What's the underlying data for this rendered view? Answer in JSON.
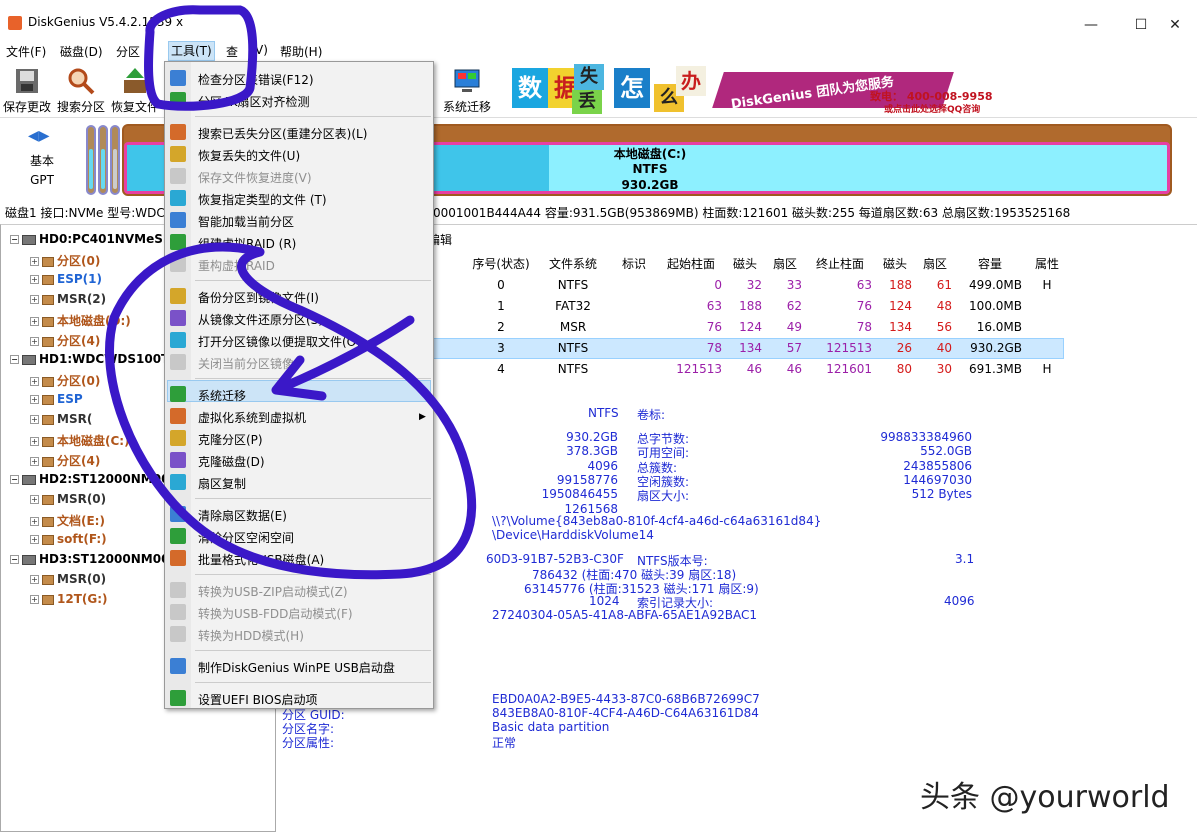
{
  "window": {
    "title": "DiskGenius V5.4.2.1239 x",
    "controls": [
      "—",
      "☐",
      "✕"
    ]
  },
  "menubar": [
    "文件(F)",
    "磁盘(D)",
    "分区",
    "工具(T)",
    "查",
    "帮助(H)"
  ],
  "menubar_tail": "V)",
  "toolbar": {
    "save": "保存更改",
    "search": "搜索分区",
    "recover": "恢复文件",
    "migrate": "系统迁移"
  },
  "banner": {
    "tiles": [
      "数",
      "据",
      "丢",
      "失",
      "怎",
      "么",
      "办"
    ],
    "ribbon": "DiskGenius 团队为您服务",
    "phone": "致电： 400-008-9958",
    "qq": "或点击此处选择QQ咨询"
  },
  "diskbar": {
    "type1": "基本",
    "type2": "GPT",
    "partition_name": "本地磁盘(C:)",
    "partition_fs": "NTFS",
    "partition_size": "930.2GB"
  },
  "diskinfo": {
    "left": "磁盘1 接口:NVMe  型号:WDC",
    "right": "0001001B444A44  容量:931.5GB(953869MB)  柱面数:121601  磁头数:255  每道扇区数:63  总扇区数:1953525168"
  },
  "tree": [
    {
      "label": "HD0:PC401NVMeSK",
      "kind": "disk",
      "level": 0
    },
    {
      "label": "分区(0)",
      "kind": "part",
      "color": "brown",
      "level": 1
    },
    {
      "label": "ESP(1)",
      "kind": "part",
      "color": "blue",
      "level": 1
    },
    {
      "label": "MSR(2)",
      "kind": "part",
      "color": "gray",
      "level": 1
    },
    {
      "label": "本地磁盘(D:)",
      "kind": "part",
      "color": "brown",
      "level": 1
    },
    {
      "label": "分区(4)",
      "kind": "part",
      "color": "brown",
      "level": 1
    },
    {
      "label": "HD1:WDCWDS100T",
      "kind": "disk",
      "level": 0
    },
    {
      "label": "分区(0)",
      "kind": "part",
      "color": "brown",
      "level": 1
    },
    {
      "label": "ESP",
      "kind": "part",
      "color": "blue",
      "level": 1
    },
    {
      "label": "MSR(",
      "kind": "part",
      "color": "gray",
      "level": 1
    },
    {
      "label": "本地磁盘(C:)",
      "kind": "part",
      "color": "brown",
      "level": 1
    },
    {
      "label": "分区(4)",
      "kind": "part",
      "color": "brown",
      "level": 1
    },
    {
      "label": "HD2:ST12000NM00",
      "kind": "disk",
      "level": 0
    },
    {
      "label": "MSR(0)",
      "kind": "part",
      "color": "gray",
      "level": 1
    },
    {
      "label": "文档(E:)",
      "kind": "part",
      "color": "brown",
      "level": 1
    },
    {
      "label": "soft(F:)",
      "kind": "part",
      "color": "brown",
      "level": 1
    },
    {
      "label": "HD3:ST12000NM00",
      "kind": "disk",
      "level": 0
    },
    {
      "label": "MSR(0)",
      "kind": "part",
      "color": "gray",
      "level": 1
    },
    {
      "label": "12T(G:)",
      "kind": "part",
      "color": "brown",
      "level": 1
    }
  ],
  "tab_label": "编辑",
  "table": {
    "headers": [
      "序号(状态)",
      "文件系统",
      "标识",
      "起始柱面",
      "磁头",
      "扇区",
      "终止柱面",
      "磁头",
      "扇区",
      "容量",
      "属性"
    ],
    "rows": [
      [
        "0",
        "NTFS",
        "",
        "0",
        "32",
        "33",
        "63",
        "188",
        "61",
        "499.0MB",
        "H"
      ],
      [
        "1",
        "FAT32",
        "",
        "63",
        "188",
        "62",
        "76",
        "124",
        "48",
        "100.0MB",
        ""
      ],
      [
        "2",
        "MSR",
        "",
        "76",
        "124",
        "49",
        "78",
        "134",
        "56",
        "16.0MB",
        ""
      ],
      [
        "3",
        "NTFS",
        "",
        "78",
        "134",
        "57",
        "121513",
        "26",
        "40",
        "930.2GB",
        ""
      ],
      [
        "4",
        "NTFS",
        "",
        "121513",
        "46",
        "46",
        "121601",
        "80",
        "30",
        "691.3MB",
        "H"
      ]
    ],
    "selected_row": 3
  },
  "details": {
    "fs": "NTFS",
    "volume_label_key": "卷标:",
    "lines": [
      {
        "v1": "930.2GB",
        "k": "总字节数:",
        "v2": "998833384960"
      },
      {
        "v1": "378.3GB",
        "k": "可用空间:",
        "v2": "552.0GB"
      },
      {
        "v1": "4096",
        "k": "总簇数:",
        "v2": "243855806"
      },
      {
        "v1": "99158776",
        "k": "空闲簇数:",
        "v2": "144697030"
      },
      {
        "v1": "1950846455",
        "k": "扇区大小:",
        "v2": "512 Bytes"
      },
      {
        "v1": "1261568",
        "k": "",
        "v2": ""
      }
    ],
    "volume_path": "\\\\?\\Volume{843eb8a0-810f-4cf4-a46d-c64a63161d84}",
    "device_path": "\\Device\\HarddiskVolume14",
    "serial": "60D3-91B7-52B3-C30F",
    "ntfs_ver_key": "NTFS版本号:",
    "ntfs_ver": "3.1",
    "mft1": "786432 (柱面:470 磁头:39 扇区:18)",
    "mft2": "63145776 (柱面:31523 磁头:171 扇区:9)",
    "index_val": "1024",
    "index_key": "索引记录大小:",
    "index_size": "4096",
    "guid_short": "27240304-05A5-41A8-ABFA-65AE1A92BAC1",
    "type_guid": "EBD0A0A2-B9E5-4433-87C0-68B6B72699C7",
    "part_guid_key": "分区 GUID:",
    "part_guid": "843EB8A0-810F-4CF4-A46D-C64A63161D84",
    "part_name_key": "分区名字:",
    "part_name": "Basic data partition",
    "part_attr_key": "分区属性:",
    "part_attr": "正常"
  },
  "dropdown": [
    {
      "label": "检查分区表错误(F12)",
      "enabled": true
    },
    {
      "label": "分区4K扇区对齐检测",
      "enabled": true
    },
    {
      "sep": true
    },
    {
      "label": "搜索已丢失分区(重建分区表)(L)",
      "enabled": true
    },
    {
      "label": "恢复丢失的文件(U)",
      "enabled": true
    },
    {
      "label": "保存文件恢复进度(V)",
      "enabled": false
    },
    {
      "label": "恢复指定类型的文件 (T)",
      "enabled": true
    },
    {
      "label": "智能加载当前分区",
      "enabled": true
    },
    {
      "label": "组建虚拟RAID (R)",
      "enabled": true
    },
    {
      "label": "重构虚拟RAID",
      "enabled": false
    },
    {
      "sep": true
    },
    {
      "label": "备份分区到镜像文件(I)",
      "enabled": true
    },
    {
      "label": "从镜像文件还原分区(S)",
      "enabled": true
    },
    {
      "label": "打开分区镜像以便提取文件(O)",
      "enabled": true
    },
    {
      "label": "关闭当前分区镜像",
      "enabled": false
    },
    {
      "sep": true
    },
    {
      "label": "系统迁移",
      "enabled": true,
      "highlight": true
    },
    {
      "label": "虚拟化系统到虚拟机",
      "enabled": true,
      "submenu": true
    },
    {
      "label": "克隆分区(P)",
      "enabled": true
    },
    {
      "label": "克隆磁盘(D)",
      "enabled": true
    },
    {
      "label": "扇区复制",
      "enabled": true
    },
    {
      "sep": true
    },
    {
      "label": "清除扇区数据(E)",
      "enabled": true
    },
    {
      "label": "清除分区空闲空间",
      "enabled": true
    },
    {
      "label": "批量格式化USB磁盘(A)",
      "enabled": true
    },
    {
      "sep": true
    },
    {
      "label": "转换为USB-ZIP启动模式(Z)",
      "enabled": false
    },
    {
      "label": "转换为USB-FDD启动模式(F)",
      "enabled": false
    },
    {
      "label": "转换为HDD模式(H)",
      "enabled": false
    },
    {
      "sep": true
    },
    {
      "label": "制作DiskGenius WinPE USB启动盘",
      "enabled": true
    },
    {
      "sep": true
    },
    {
      "label": "设置UEFI BIOS启动项",
      "enabled": true
    }
  ],
  "watermark": "头条 @yourworld",
  "colors": {
    "annotation": "#3a18c8",
    "selection": "#cce8ff",
    "purple_num": "#9b1fa8",
    "red_num": "#d41a1a"
  }
}
